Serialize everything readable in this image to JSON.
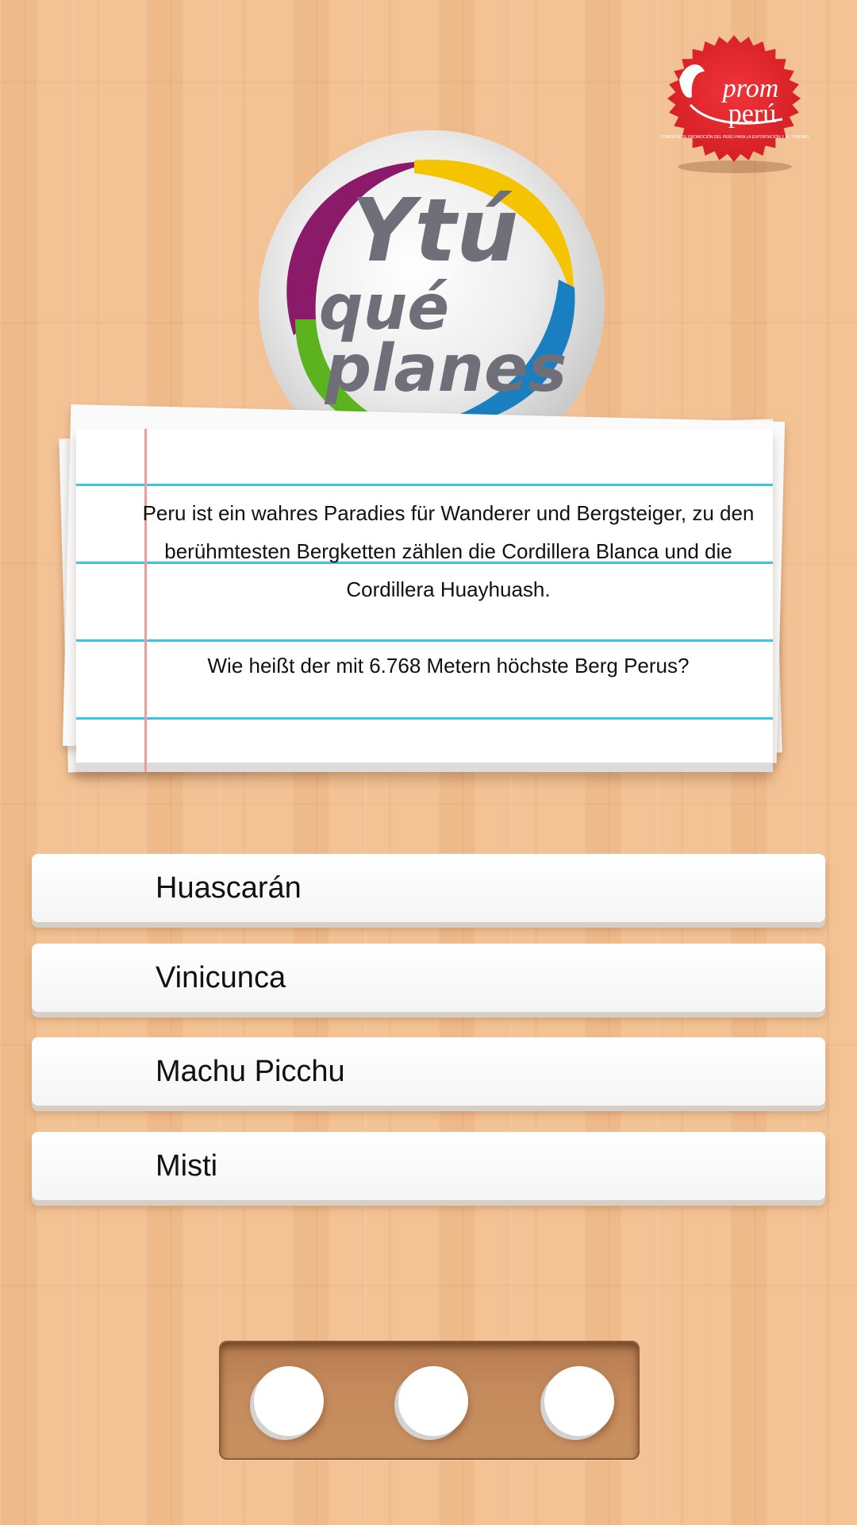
{
  "brand": {
    "promperu_logo_text_1": "prom",
    "promperu_logo_text_2": "perú",
    "promperu_tagline": "COMISIÓN DE PROMOCIÓN DEL PERÚ PARA LA EXPORTACIÓN Y EL TURISMO",
    "seal_color": "#e8232a"
  },
  "game_logo": {
    "line1": "Ytú",
    "line2": "qué",
    "line3": "planes",
    "colors": [
      "#8b1a6b",
      "#f5c400",
      "#1a7fc1",
      "#5bb41e"
    ]
  },
  "card": {
    "intro": "Peru ist ein wahres Paradies für Wanderer und Bergsteiger, zu den berühmtesten Bergketten zählen die Cordillera Blanca und die Cordillera Huayhuash.",
    "question": "Wie heißt der mit 6.768 Metern höchste Berg Perus?",
    "line_color": "#3cc4e3",
    "margin_color": "#f29a9a"
  },
  "answers": [
    {
      "label": "Huascarán"
    },
    {
      "label": "Vinicunca"
    },
    {
      "label": "Machu Picchu"
    },
    {
      "label": "Misti"
    }
  ],
  "lives": {
    "total": 3,
    "remaining": 3
  }
}
